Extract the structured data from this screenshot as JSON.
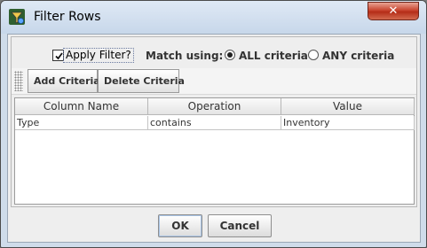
{
  "window": {
    "title": "Filter Rows",
    "close_glyph": "✕",
    "icon": "filter-funnel-icon"
  },
  "options": {
    "apply_filter_label": "Apply Filter?",
    "apply_filter_checked": true,
    "match_label": "Match using:",
    "match_options": [
      {
        "label": "ALL criteria",
        "selected": true
      },
      {
        "label": "ANY criteria",
        "selected": false
      }
    ]
  },
  "toolbar": {
    "add_label": "Add Criteria",
    "delete_label": "Delete Criteria"
  },
  "table": {
    "columns": [
      "Column Name",
      "Operation",
      "Value"
    ],
    "rows": [
      [
        "Type",
        "contains",
        "Inventory"
      ]
    ]
  },
  "footer": {
    "ok_label": "OK",
    "cancel_label": "Cancel"
  },
  "colors": {
    "titlebar": "#c7d7ea",
    "close_button": "#c9452f",
    "dialog_background": "#eeeeee"
  }
}
